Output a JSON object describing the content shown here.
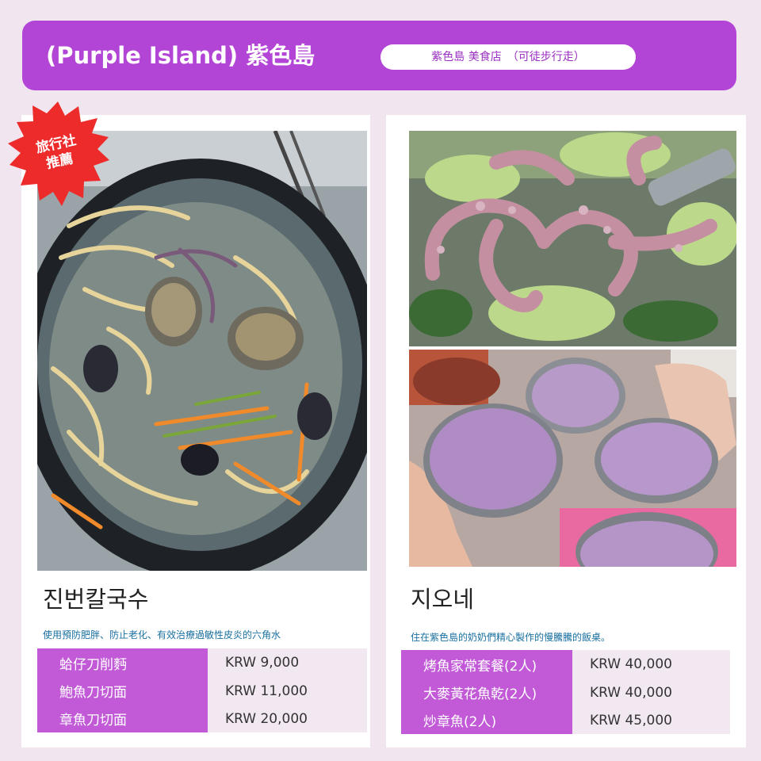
{
  "header": {
    "title": "(Purple Island) 紫色島",
    "pill": "紫色島 美食店　（可徒步行走）"
  },
  "badge": {
    "line1": "旅行社",
    "line2": "推薦"
  },
  "left_card": {
    "title": "진번칼국수",
    "description": "使用預防肥胖、防止老化、有效治療過敏性皮炎的六角水",
    "menu": [
      {
        "name": "蛤仔刀削麪",
        "price": "KRW 9,000"
      },
      {
        "name": "鮑魚刀切面",
        "price": "KRW 11,000"
      },
      {
        "name": "章魚刀切面",
        "price": "KRW 20,000"
      }
    ]
  },
  "right_card": {
    "title": "지오네",
    "description": "住在紫色島的奶奶們精心製作的慢騰騰的飯桌。",
    "menu": [
      {
        "name": "烤魚家常套餐(2人)",
        "price": "KRW 40,000"
      },
      {
        "name": "大麥黃花魚乾(2人)",
        "price": "KRW 40,000"
      },
      {
        "name": "炒章魚(2人)",
        "price": "KRW 45,000"
      }
    ]
  },
  "colors": {
    "header_bg": "#b244d6",
    "menu_name_bg": "#c25ad8",
    "menu_price_bg": "#f2e8f1",
    "badge_red": "#ee2b2b",
    "page_bg": "#f1e5ef"
  }
}
